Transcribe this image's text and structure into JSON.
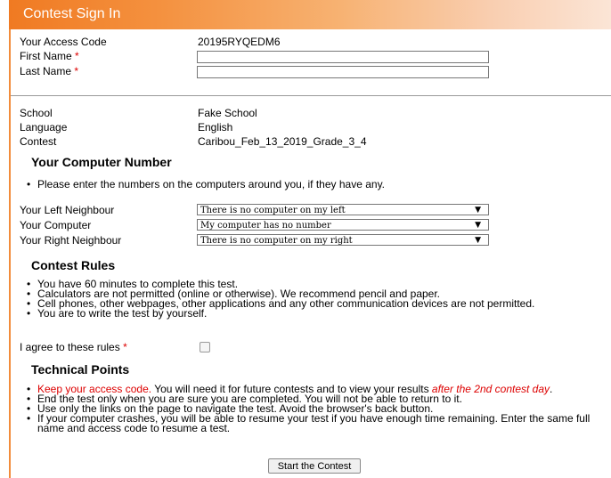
{
  "header": {
    "title": "Contest Sign In"
  },
  "identity": {
    "access_code_label": "Your Access Code",
    "access_code_value": "20195RYQEDM6",
    "first_name_label": "First Name",
    "last_name_label": "Last Name",
    "required_marker": "*"
  },
  "info": {
    "school_label": "School",
    "school_value": "Fake School",
    "language_label": "Language",
    "language_value": "English",
    "contest_label": "Contest",
    "contest_value": "Caribou_Feb_13_2019_Grade_3_4"
  },
  "computer": {
    "title": "Your Computer Number",
    "instruction": "Please enter the numbers on the computers around you, if they have any.",
    "left_label": "Your Left Neighbour",
    "left_value": "There is no computer on my left",
    "mine_label": "Your Computer",
    "mine_value": "My computer has no number",
    "right_label": "Your Right Neighbour",
    "right_value": "There is no computer on my right",
    "arrow": "▼"
  },
  "rules": {
    "title": "Contest Rules",
    "items": [
      "You have 60 minutes to complete this test.",
      "Calculators are not permitted (online or otherwise). We recommend pencil and paper.",
      "Cell phones, other webpages, other applications and any other communication devices are not permitted.",
      "You are to write the test by yourself."
    ],
    "agree_label": "I agree to these rules"
  },
  "technical": {
    "title": "Technical Points",
    "item1_red": "Keep your access code.",
    "item1_mid": " You will need it for future contests and to view your results ",
    "item1_italic": "after the 2nd contest day",
    "item1_end": ".",
    "items": [
      "End the test only when you are sure you are completed. You will not be able to return to it.",
      "Use only the links on the page to navigate the test. Avoid the browser's back button.",
      "If your computer crashes, you will be able to resume your test if you have enough time remaining. Enter the same full name and access code to resume a test."
    ]
  },
  "actions": {
    "start_label": "Start the Contest"
  }
}
